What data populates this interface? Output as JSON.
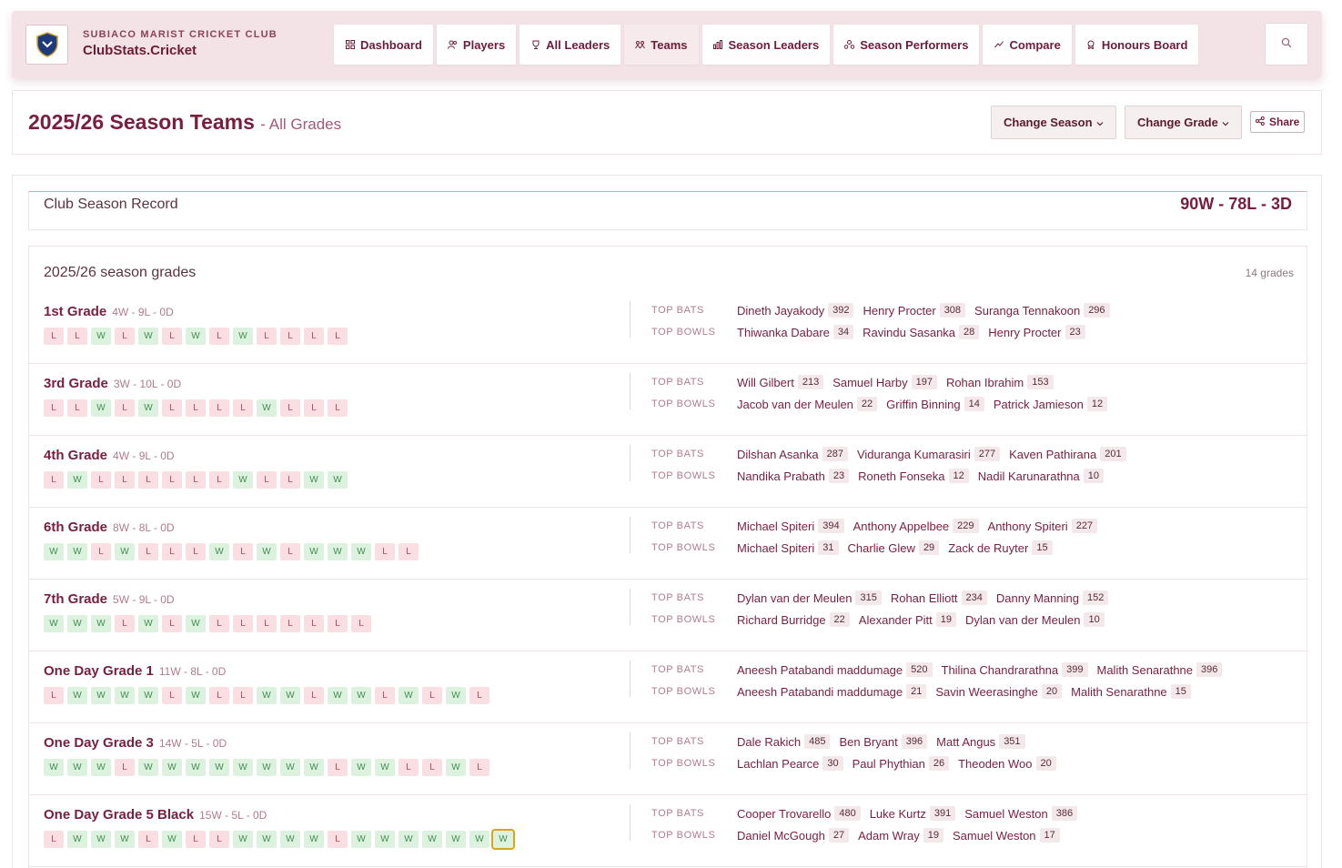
{
  "header": {
    "club": "SUBIACO MARIST CRICKET CLUB",
    "site": "ClubStats.Cricket",
    "nav": [
      {
        "label": "Dashboard",
        "icon": "dashboard-icon"
      },
      {
        "label": "Players",
        "icon": "players-icon"
      },
      {
        "label": "All Leaders",
        "icon": "trophy-icon"
      },
      {
        "label": "Teams",
        "icon": "teams-icon",
        "active": true
      },
      {
        "label": "Season Leaders",
        "icon": "bar-chart-icon"
      },
      {
        "label": "Season Performers",
        "icon": "performers-icon"
      },
      {
        "label": "Compare",
        "icon": "compare-icon"
      },
      {
        "label": "Honours Board",
        "icon": "medal-icon"
      }
    ]
  },
  "title": {
    "main": "2025/26 Season Teams",
    "sub": "- All Grades",
    "change_season": "Change Season",
    "change_grade": "Change Grade",
    "share": "Share"
  },
  "record": {
    "label": "Club Season Record",
    "value": "90W - 78L - 3D"
  },
  "grades_panel": {
    "title": "2025/26 season grades",
    "count": "14 grades",
    "top_bats_label": "TOP BATS",
    "top_bowls_label": "TOP BOWLS"
  },
  "grades": [
    {
      "name": "1st Grade",
      "record": "4W - 9L - 0D",
      "results": [
        "L",
        "L",
        "W",
        "L",
        "W",
        "L",
        "W",
        "L",
        "W",
        "L",
        "L",
        "L",
        "L"
      ],
      "bats": [
        [
          "Dineth Jayakody",
          "392"
        ],
        [
          "Henry Procter",
          "308"
        ],
        [
          "Suranga Tennakoon",
          "296"
        ]
      ],
      "bowls": [
        [
          "Thiwanka Dabare",
          "34"
        ],
        [
          "Ravindu Sasanka",
          "28"
        ],
        [
          "Henry Procter",
          "23"
        ]
      ]
    },
    {
      "name": "3rd Grade",
      "record": "3W - 10L - 0D",
      "results": [
        "L",
        "L",
        "W",
        "L",
        "W",
        "L",
        "L",
        "L",
        "L",
        "W",
        "L",
        "L",
        "L"
      ],
      "bats": [
        [
          "Will Gilbert",
          "213"
        ],
        [
          "Samuel Harby",
          "197"
        ],
        [
          "Rohan Ibrahim",
          "153"
        ]
      ],
      "bowls": [
        [
          "Jacob van der Meulen",
          "22"
        ],
        [
          "Griffin Binning",
          "14"
        ],
        [
          "Patrick Jamieson",
          "12"
        ]
      ]
    },
    {
      "name": "4th Grade",
      "record": "4W - 9L - 0D",
      "results": [
        "L",
        "W",
        "L",
        "L",
        "L",
        "L",
        "L",
        "L",
        "W",
        "L",
        "L",
        "W",
        "W"
      ],
      "bats": [
        [
          "Dilshan Asanka",
          "287"
        ],
        [
          "Viduranga Kumarasiri",
          "277"
        ],
        [
          "Kaven Pathirana",
          "201"
        ]
      ],
      "bowls": [
        [
          "Nandika Prabath",
          "23"
        ],
        [
          "Roneth Fonseka",
          "12"
        ],
        [
          "Nadil Karunarathna",
          "10"
        ]
      ]
    },
    {
      "name": "6th Grade",
      "record": "8W - 8L - 0D",
      "results": [
        "W",
        "W",
        "L",
        "W",
        "L",
        "L",
        "L",
        "W",
        "L",
        "W",
        "L",
        "W",
        "W",
        "W",
        "L",
        "L"
      ],
      "bats": [
        [
          "Michael Spiteri",
          "394"
        ],
        [
          "Anthony Appelbee",
          "229"
        ],
        [
          "Anthony Spiteri",
          "227"
        ]
      ],
      "bowls": [
        [
          "Michael Spiteri",
          "31"
        ],
        [
          "Charlie Glew",
          "29"
        ],
        [
          "Zack de Ruyter",
          "15"
        ]
      ]
    },
    {
      "name": "7th Grade",
      "record": "5W - 9L - 0D",
      "results": [
        "W",
        "W",
        "W",
        "L",
        "W",
        "L",
        "W",
        "L",
        "L",
        "L",
        "L",
        "L",
        "L",
        "L"
      ],
      "bats": [
        [
          "Dylan van der Meulen",
          "315"
        ],
        [
          "Rohan Elliott",
          "234"
        ],
        [
          "Danny Manning",
          "152"
        ]
      ],
      "bowls": [
        [
          "Richard Burridge",
          "22"
        ],
        [
          "Alexander Pitt",
          "19"
        ],
        [
          "Dylan van der Meulen",
          "10"
        ]
      ]
    },
    {
      "name": "One Day Grade 1",
      "record": "11W - 8L - 0D",
      "results": [
        "L",
        "W",
        "W",
        "W",
        "W",
        "L",
        "W",
        "L",
        "L",
        "W",
        "W",
        "L",
        "W",
        "W",
        "L",
        "W",
        "L",
        "W",
        "L"
      ],
      "bats": [
        [
          "Aneesh Patabandi maddumage",
          "520"
        ],
        [
          "Thilina Chandrarathna",
          "399"
        ],
        [
          "Malith Senarathne",
          "396"
        ]
      ],
      "bowls": [
        [
          "Aneesh Patabandi maddumage",
          "21"
        ],
        [
          "Savin Weerasinghe",
          "20"
        ],
        [
          "Malith Senarathne",
          "15"
        ]
      ]
    },
    {
      "name": "One Day Grade 3",
      "record": "14W - 5L - 0D",
      "results": [
        "W",
        "W",
        "W",
        "L",
        "W",
        "W",
        "W",
        "W",
        "W",
        "W",
        "W",
        "W",
        "L",
        "W",
        "W",
        "L",
        "L",
        "W",
        "L"
      ],
      "bats": [
        [
          "Dale Rakich",
          "485"
        ],
        [
          "Ben Bryant",
          "396"
        ],
        [
          "Matt Angus",
          "351"
        ]
      ],
      "bowls": [
        [
          "Lachlan Pearce",
          "30"
        ],
        [
          "Paul Phythian",
          "26"
        ],
        [
          "Theoden Woo",
          "20"
        ]
      ]
    },
    {
      "name": "One Day Grade 5 Black",
      "record": "15W - 5L - 0D",
      "results": [
        "L",
        "W",
        "W",
        "W",
        "L",
        "W",
        "L",
        "L",
        "W",
        "W",
        "W",
        "W",
        "L",
        "W",
        "W",
        "W",
        "W",
        "W",
        "W",
        "W"
      ],
      "bats": [
        [
          "Cooper Trovarello",
          "480"
        ],
        [
          "Luke Kurtz",
          "391"
        ],
        [
          "Samuel Weston",
          "386"
        ]
      ],
      "bowls": [
        [
          "Daniel McGough",
          "27"
        ],
        [
          "Adam Wray",
          "19"
        ],
        [
          "Samuel Weston",
          "17"
        ]
      ]
    }
  ]
}
